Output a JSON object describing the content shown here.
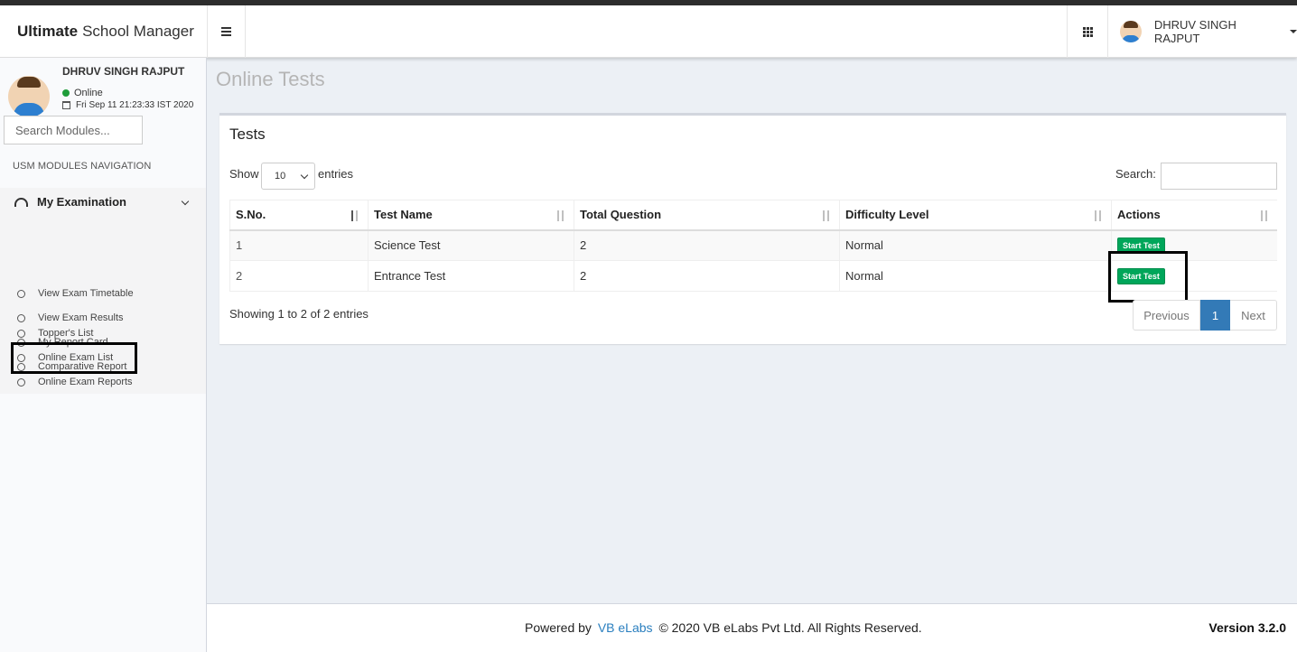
{
  "header": {
    "brand_bold": "Ultimate",
    "brand_rest": "School Manager",
    "user_name": "DHRUV SINGH RAJPUT"
  },
  "sidebar": {
    "user_name": "DHRUV SINGH RAJPUT",
    "status": "Online",
    "datetime": "Fri Sep 11 21:23:33 IST 2020",
    "search_placeholder": "Search Modules...",
    "nav_header": "USM MODULES NAVIGATION",
    "section_title": "My Examination",
    "items": [
      {
        "label": "View Exam Timetable"
      },
      {
        "label": "View Exam Results"
      },
      {
        "label": "My Report Card"
      },
      {
        "label": "Comparative Report"
      },
      {
        "label": "Topper's List"
      },
      {
        "label": "Online Exam List"
      },
      {
        "label": "Online Exam Reports"
      }
    ]
  },
  "page": {
    "title": "Online Tests"
  },
  "tests_box": {
    "title": "Tests",
    "show_label": "Show",
    "entries_value": "10",
    "entries_label": "entries",
    "search_label": "Search:",
    "columns": [
      "S.No.",
      "Test Name",
      "Total Question",
      "Difficulty Level",
      "Actions"
    ],
    "rows": [
      {
        "sno": "1",
        "name": "Science Test",
        "total": "2",
        "difficulty": "Normal",
        "action": "Start Test"
      },
      {
        "sno": "2",
        "name": "Entrance Test",
        "total": "2",
        "difficulty": "Normal",
        "action": "Start Test"
      }
    ],
    "info": "Showing 1 to 2 of 2 entries",
    "pager": {
      "prev": "Previous",
      "current": "1",
      "next": "Next"
    }
  },
  "footer": {
    "powered_by": "Powered by",
    "link": "VB eLabs",
    "copyright": "© 2020 VB eLabs Pvt Ltd. All Rights Reserved.",
    "version": "Version 3.2.0"
  },
  "colors": {
    "accent": "#337ab7",
    "success": "#00a65a",
    "link": "#2a7fbf"
  }
}
